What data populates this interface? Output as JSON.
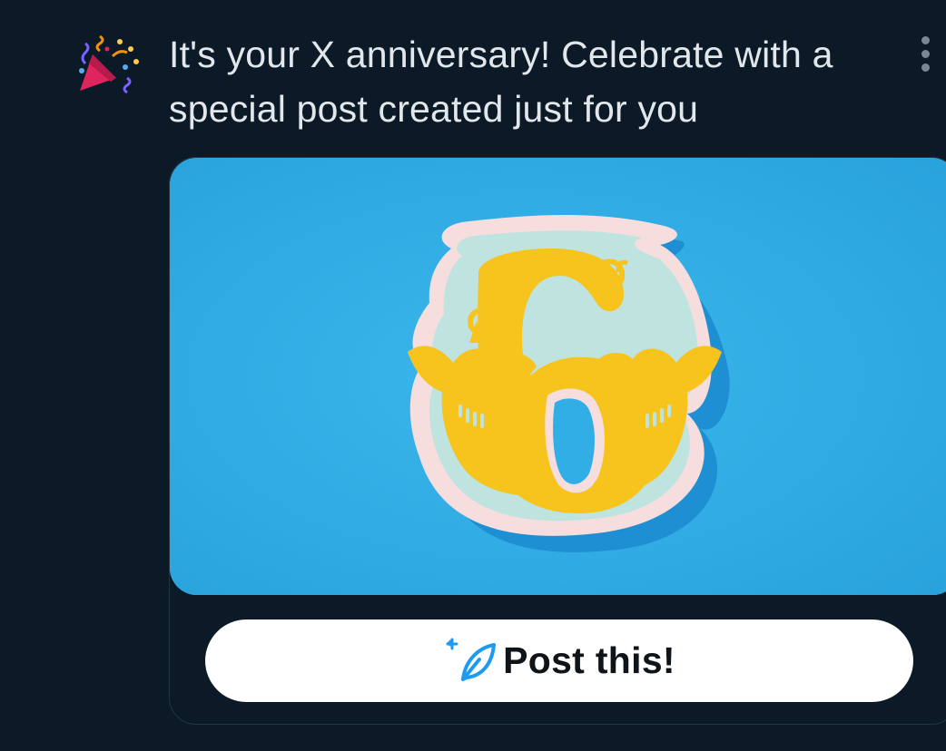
{
  "notification": {
    "icon": "party-popper-icon",
    "text": "It's your X anniversary! Celebrate with a special post created just for you"
  },
  "image": {
    "subject": "6",
    "colors": {
      "background": "#31aee6",
      "shadow": "#1f8fd3",
      "paper": "#f6dede",
      "mint": "#bfe3df",
      "gold": "#f7c31d"
    }
  },
  "post_button": {
    "icon": "sparkle-feather-icon",
    "label": "Post this!"
  }
}
